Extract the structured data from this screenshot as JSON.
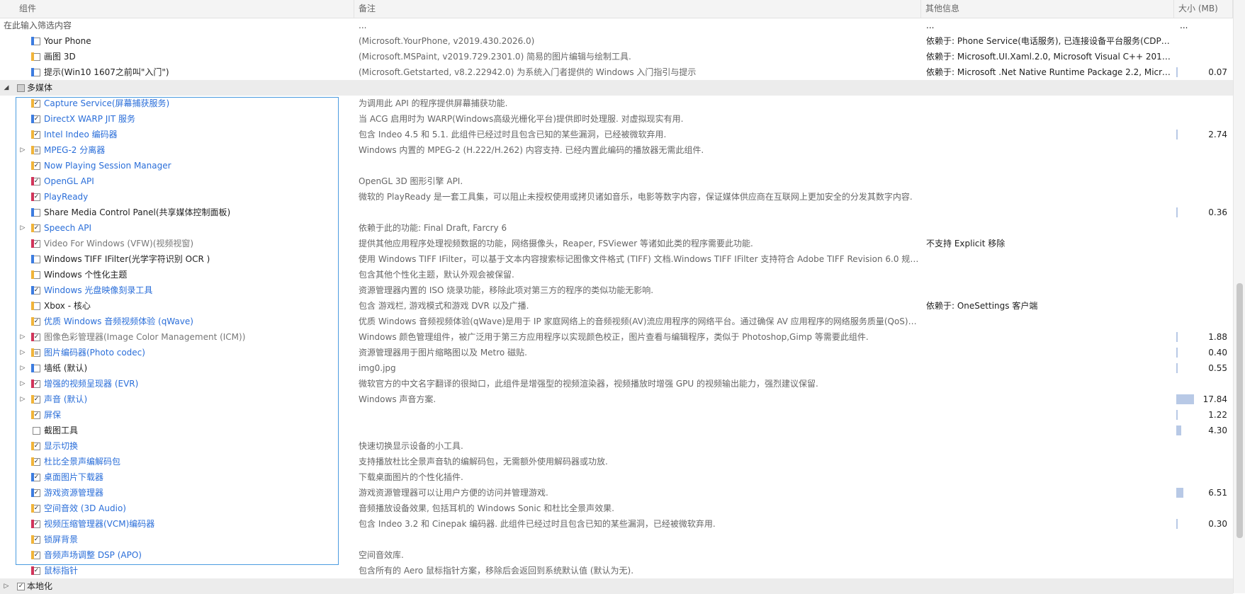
{
  "columns": {
    "component": "组件",
    "note": "备注",
    "other": "其他信息",
    "size": "大小 (MB)"
  },
  "filter_row": {
    "placeholder": "在此输入筛选内容",
    "note": "...",
    "other": "...",
    "size": "..."
  },
  "rows": [
    {
      "kind": "item",
      "depth": 1,
      "checked": false,
      "color": "#3c7ce0",
      "text_color": "",
      "name": "Your Phone",
      "note": "(Microsoft.YourPhone, v2019.430.2026.0)",
      "other": "依赖于: Phone Service(电话服务), 已连接设备平台服务(CDPSv...",
      "size": ""
    },
    {
      "kind": "item",
      "depth": 1,
      "checked": false,
      "color": "#f0b43a",
      "text_color": "",
      "name": "画图 3D",
      "note": "(Microsoft.MSPaint, v2019.729.2301.0) 简易的图片编辑与绘制工具.",
      "other": "依赖于: Microsoft.UI.Xaml.2.0, Microsoft Visual C++ 2015 ...",
      "size": ""
    },
    {
      "kind": "item",
      "depth": 1,
      "checked": false,
      "color": "#3c7ce0",
      "text_color": "",
      "name": "提示(Win10 1607之前叫\"入门\")",
      "note": "(Microsoft.Getstarted, v8.2.22942.0) 为系统入门者提供的 Windows 入门指引与提示",
      "other": "依赖于: Microsoft .Net Native Runtime Package 2.2, Micro...",
      "size": "0.07",
      "bar": 0
    },
    {
      "kind": "category",
      "expanded": true,
      "name": "多媒体"
    },
    {
      "kind": "item",
      "depth": 1,
      "checked": true,
      "color": "#f0b43a",
      "text_color": "blue",
      "name": "Capture Service(屏幕捕获服务)",
      "note": "为调用此 API 的程序提供屏幕捕获功能.",
      "other": "",
      "size": ""
    },
    {
      "kind": "item",
      "depth": 1,
      "checked": true,
      "color": "#3c7ce0",
      "text_color": "blue",
      "name": "DirectX WARP JIT 服务",
      "note": "当 ACG 启用时为 WARP(Windows高级光栅化平台)提供即时处理服. 对虚拟现实有用.",
      "other": "",
      "size": ""
    },
    {
      "kind": "item",
      "depth": 1,
      "checked": true,
      "color": "#f0b43a",
      "text_color": "blue",
      "name": "Intel Indeo 编码器",
      "note": "包含 Indeo 4.5 和 5.1. 此组件已经过时且包含已知的某些漏洞，已经被微软弃用.",
      "other": "",
      "size": "2.74",
      "bar": 0.02
    },
    {
      "kind": "item",
      "depth": 1,
      "expander": true,
      "checked": false,
      "partial": true,
      "color": "#f0b43a",
      "text_color": "blue",
      "name": "MPEG-2 分离器",
      "note": "Windows 内置的 MPEG-2 (H.222/H.262) 内容支持. 已经内置此编码的播放器无需此组件.",
      "other": "",
      "size": ""
    },
    {
      "kind": "item",
      "depth": 1,
      "checked": true,
      "color": "#f0b43a",
      "text_color": "blue",
      "name": "Now Playing Session Manager",
      "note": "",
      "other": "",
      "size": ""
    },
    {
      "kind": "item",
      "depth": 1,
      "checked": true,
      "color": "#d0345a",
      "text_color": "blue",
      "name": "OpenGL API",
      "note": "OpenGL 3D 图形引擎 API.",
      "other": "",
      "size": ""
    },
    {
      "kind": "item",
      "depth": 1,
      "checked": true,
      "color": "#d0345a",
      "text_color": "blue",
      "name": "PlayReady",
      "note": "微软的 PlayReady 是一套工具集，可以阻止未授权使用或拷贝诸如音乐，电影等数字内容，保证媒体供应商在互联网上更加安全的分发其数字内容.",
      "other": "",
      "size": ""
    },
    {
      "kind": "item",
      "depth": 1,
      "checked": false,
      "color": "#3c7ce0",
      "text_color": "",
      "name": "Share Media Control Panel(共享媒体控制面板)",
      "note": "",
      "other": "",
      "size": "0.36",
      "bar": 0
    },
    {
      "kind": "item",
      "depth": 1,
      "expander": true,
      "checked": true,
      "color": "#f0b43a",
      "text_color": "blue",
      "name": "Speech API",
      "note": "依赖于此的功能: Final Draft, Farcry 6",
      "other": "",
      "size": ""
    },
    {
      "kind": "item",
      "depth": 1,
      "checked": true,
      "color": "#d0345a",
      "text_color": "gray",
      "name": "Video For Windows (VFW)(视频视窗)",
      "note": "提供其他应用程序处理视频数据的功能，网络摄像头，Reaper, FSViewer 等诸如此类的程序需要此功能.",
      "other": "不支持 Explicit 移除",
      "size": ""
    },
    {
      "kind": "item",
      "depth": 1,
      "checked": false,
      "color": "#3c7ce0",
      "text_color": "",
      "name": "Windows TIFF IFilter(光学字符识别 OCR )",
      "note": "使用 Windows TIFF IFilter，可以基于文本内容搜索标记图像文件格式 (TIFF) 文档.Windows TIFF IFilter 支持符合 Adobe TIFF Revision 6.0 规范...",
      "other": "",
      "size": ""
    },
    {
      "kind": "item",
      "depth": 1,
      "checked": false,
      "color": "#f0b43a",
      "text_color": "",
      "name": "Windows 个性化主题",
      "note": "包含其他个性化主题，默认外观会被保留.",
      "other": "",
      "size": ""
    },
    {
      "kind": "item",
      "depth": 1,
      "checked": true,
      "color": "#3c7ce0",
      "text_color": "blue",
      "name": "Windows 光盘映像刻录工具",
      "note": "资源管理器内置的 ISO 烧录功能，移除此项对第三方的程序的类似功能无影响.",
      "other": "",
      "size": ""
    },
    {
      "kind": "item",
      "depth": 1,
      "checked": false,
      "color": "#f0b43a",
      "text_color": "",
      "name": "Xbox - 核心",
      "note": "包含 游戏栏, 游戏模式和游戏 DVR 以及广播.",
      "other": "依赖于: OneSettings 客户端",
      "size": ""
    },
    {
      "kind": "item",
      "depth": 1,
      "checked": true,
      "color": "#f0b43a",
      "text_color": "blue",
      "name": "优质 Windows 音频视频体验 (qWave)",
      "note": "优质 Windows 音频视频体验(qWave)是用于 IP 家庭网络上的音频视频(AV)流应用程序的网络平台。通过确保 AV 应用程序的网络服务质量(QoS)，...",
      "other": "",
      "size": ""
    },
    {
      "kind": "item",
      "depth": 1,
      "expander": true,
      "checked": true,
      "color": "#d0345a",
      "text_color": "gray",
      "name": "图像色彩管理器(Image Color Management (ICM))",
      "note": "Windows 颜色管理组件，被广泛用于第三方应用程序以实现颜色校正，图片查看与编辑程序，类似于 Photoshop,Gimp 等需要此组件.",
      "other": "",
      "size": "1.88",
      "bar": 0.02
    },
    {
      "kind": "item",
      "depth": 1,
      "expander": true,
      "checked": false,
      "partial": true,
      "color": "#f0b43a",
      "text_color": "blue",
      "name": "图片编码器(Photo codec)",
      "note": "资源管理器用于图片缩略图以及 Metro 磁贴.",
      "other": "",
      "size": "0.40",
      "bar": 0.02
    },
    {
      "kind": "item",
      "depth": 1,
      "expander": true,
      "checked": false,
      "color": "#3c7ce0",
      "text_color": "",
      "name": "墙纸 (默认)",
      "note": "img0.jpg",
      "other": "",
      "size": "0.55",
      "bar": 0.02
    },
    {
      "kind": "item",
      "depth": 1,
      "expander": true,
      "checked": true,
      "color": "#d0345a",
      "text_color": "blue",
      "name": "增强的视频呈现器 (EVR)",
      "note": "微软官方的中文名字翻译的很拗口，此组件是增强型的视频渲染器，视频播放时增强 GPU 的视频输出能力，强烈建议保留.",
      "other": "",
      "size": ""
    },
    {
      "kind": "item",
      "depth": 1,
      "expander": true,
      "checked": true,
      "color": "#f0b43a",
      "text_color": "blue",
      "name": "声音 (默认)",
      "note": "Windows 声音方案.",
      "other": "",
      "size": "17.84",
      "bar": 0.3
    },
    {
      "kind": "item",
      "depth": 1,
      "checked": true,
      "color": "#f0b43a",
      "text_color": "blue",
      "name": "屏保",
      "note": "",
      "other": "",
      "size": "1.22",
      "bar": 0.02
    },
    {
      "kind": "item",
      "depth": 1,
      "checked": false,
      "color": "",
      "text_color": "",
      "name": "截图工具",
      "note": "",
      "other": "",
      "size": "4.30",
      "bar": 0.08
    },
    {
      "kind": "item",
      "depth": 1,
      "checked": true,
      "color": "#f0b43a",
      "text_color": "blue",
      "name": "显示切换",
      "note": "快速切换显示设备的小工具.",
      "other": "",
      "size": ""
    },
    {
      "kind": "item",
      "depth": 1,
      "checked": true,
      "color": "#f0b43a",
      "text_color": "blue",
      "name": "杜比全景声编解码包",
      "note": "支持播放杜比全景声音轨的编解码包，无需额外使用解码器或功放.",
      "other": "",
      "size": ""
    },
    {
      "kind": "item",
      "depth": 1,
      "checked": true,
      "color": "#3c7ce0",
      "text_color": "blue",
      "name": "桌面图片下载器",
      "note": "下载桌面图片的个性化插件.",
      "other": "",
      "size": ""
    },
    {
      "kind": "item",
      "depth": 1,
      "checked": true,
      "color": "#3c7ce0",
      "text_color": "blue",
      "name": "游戏资源管理器",
      "note": "游戏资源管理器可以让用户方便的访问并管理游戏.",
      "other": "",
      "size": "6.51",
      "bar": 0.12
    },
    {
      "kind": "item",
      "depth": 1,
      "checked": true,
      "color": "#f0b43a",
      "text_color": "blue",
      "name": "空间音效 (3D Audio)",
      "note": "音频播放设备效果, 包括耳机的 Windows Sonic 和杜比全景声效果.",
      "other": "",
      "size": ""
    },
    {
      "kind": "item",
      "depth": 1,
      "checked": true,
      "color": "#d0345a",
      "text_color": "blue",
      "name": "视频压缩管理器(VCM)编码器",
      "note": "包含 Indeo 3.2 和 Cinepak 编码器. 此组件已经过时且包含已知的某些漏洞，已经被微软弃用.",
      "other": "",
      "size": "0.30",
      "bar": 0.02
    },
    {
      "kind": "item",
      "depth": 1,
      "checked": true,
      "color": "#f0b43a",
      "text_color": "blue",
      "name": "锁屏背景",
      "note": "",
      "other": "",
      "size": ""
    },
    {
      "kind": "item",
      "depth": 1,
      "checked": true,
      "color": "#f0b43a",
      "text_color": "blue",
      "name": "音频声场调整 DSP (APO)",
      "note": "空间音效库.",
      "other": "",
      "size": ""
    },
    {
      "kind": "item",
      "depth": 1,
      "checked": true,
      "color": "#d0345a",
      "text_color": "blue",
      "name": "鼠标指针",
      "note": "包含所有的 Aero 鼠标指针方案，移除后会返回到系统默认值 (默认为无).",
      "other": "",
      "size": ""
    },
    {
      "kind": "category",
      "expanded": false,
      "checked": true,
      "name": "本地化"
    }
  ]
}
